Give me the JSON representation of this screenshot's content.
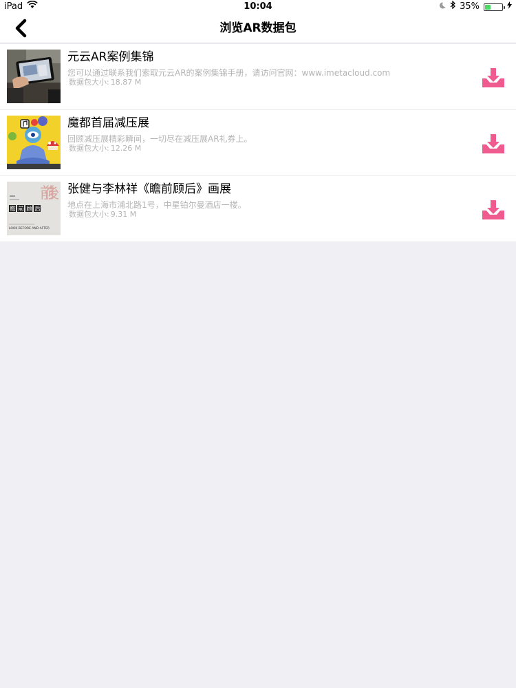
{
  "status_bar": {
    "device": "iPad",
    "time": "10:04",
    "battery_pct": "35%",
    "battery_level": 0.35,
    "icons": [
      "wifi-icon",
      "moon-icon",
      "bluetooth-icon",
      "battery-icon",
      "charging-icon"
    ]
  },
  "nav": {
    "title": "浏览AR数据包",
    "back_icon": "chevron-left-icon"
  },
  "colors": {
    "accent": "#ef5b8f",
    "background": "#efeff4",
    "subtext": "#b4b4b4"
  },
  "packages": [
    {
      "title": "元云AR案例集锦",
      "description": "您可以通过联系我们索取元云AR的案例集锦手册，请访问官网：www.imetacloud.com",
      "size_label": "数据包大小:",
      "size_value": "18.87 M",
      "thumb": "tablet-photo-thumbnail",
      "action_icon": "download-icon"
    },
    {
      "title": "魔都首届减压展",
      "description": "回顾减压展精彩瞬间，一切尽在减压展AR礼券上。",
      "size_label": "数据包大小:",
      "size_value": "12.26 M",
      "thumb": "meditation-art-thumbnail",
      "action_icon": "download-icon"
    },
    {
      "title": "张健与李林祥《瞻前顾后》画展",
      "description": "地点在上海市浦北路1号，中星铂尔曼酒店一楼。",
      "size_label": "数据包大小:",
      "size_value": "9.31 M",
      "thumb": "exhibition-poster-thumbnail",
      "action_icon": "download-icon",
      "thumb_text": {
        "big_chars": "前後",
        "badge_chars": [
          "瞻",
          "前",
          "顾",
          "后"
        ],
        "caption": "LOOK BEFORE AND AFTER"
      }
    }
  ]
}
